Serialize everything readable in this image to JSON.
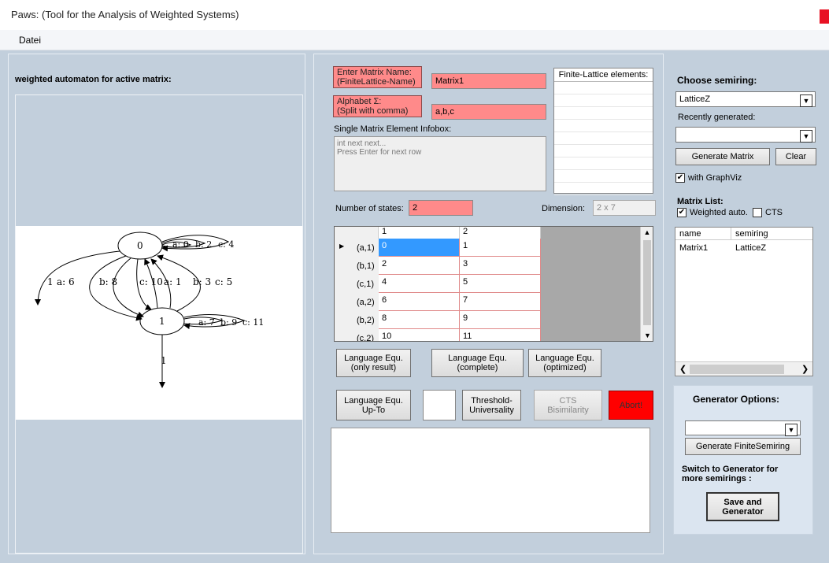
{
  "window": {
    "title": "Paws: (Tool for the Analysis of Weighted Systems)"
  },
  "menu": {
    "items": [
      "Datei"
    ]
  },
  "left_panel": {
    "heading": "weighted automaton for active matrix:",
    "graph": {
      "nodes": [
        "0",
        "1"
      ],
      "edge_labels": [
        "a: 0",
        "b: 2",
        "c: 4",
        "1",
        "a: 6",
        "b: 8",
        "c: 10",
        "a: 1",
        "b: 3",
        "c: 5",
        "a: 7",
        "b: 9",
        "c: 11",
        "1"
      ]
    }
  },
  "matrix_form": {
    "name_label": "Enter Matrix Name:\n(FiniteLattice-Name)",
    "name_value": "Matrix1",
    "alphabet_label": "Alphabet Σ:\n(Split with comma)",
    "alphabet_value": "a,b,c",
    "infobox_label": "Single Matrix Element Infobox:",
    "infobox_text": "int next next...\nPress Enter for next row",
    "states_label": "Number of states:",
    "states_value": "2",
    "dimension_label": "Dimension:",
    "dimension_value": "2 x 7",
    "lattice_header": "Finite-Lattice elements:"
  },
  "matrix_grid": {
    "columns": [
      "1",
      "2"
    ],
    "rows": [
      {
        "header": "(a,1)",
        "cells": [
          "0",
          "1"
        ],
        "current": true
      },
      {
        "header": "(b,1)",
        "cells": [
          "2",
          "3"
        ]
      },
      {
        "header": "(c,1)",
        "cells": [
          "4",
          "5"
        ]
      },
      {
        "header": "(a,2)",
        "cells": [
          "6",
          "7"
        ]
      },
      {
        "header": "(b,2)",
        "cells": [
          "8",
          "9"
        ]
      },
      {
        "header": "(c,2)",
        "cells": [
          "10",
          "11"
        ]
      }
    ]
  },
  "actions": {
    "lang_only_result": "Language Equ.\n(only result)",
    "lang_complete": "Language Equ.\n(complete)",
    "lang_optimized": "Language Equ.\n(optimized)",
    "lang_up_to": "Language Equ.\nUp-To",
    "threshold": "Threshold-\nUniversality",
    "cts_bisim": "CTS\nBisimilarity",
    "abort": "Abort!"
  },
  "semiring": {
    "heading": "Choose semiring:",
    "selected": "LatticeZ",
    "recent_label": "Recently  generated:",
    "recent_value": "",
    "generate_matrix": "Generate Matrix",
    "clear": "Clear",
    "with_graphviz": "with GraphViz",
    "with_graphviz_checked": true
  },
  "matrix_list": {
    "heading": "Matrix List:",
    "weighted_auto": "Weighted auto.",
    "weighted_checked": true,
    "cts": "CTS",
    "cts_checked": false,
    "columns": [
      "name",
      "semiring"
    ],
    "rows": [
      {
        "name": "Matrix1",
        "semiring": "LatticeZ"
      }
    ]
  },
  "generator": {
    "heading": "Generator Options:",
    "combo_value": "",
    "generate_finite": "Generate FiniteSemiring",
    "switch_text": "Switch to Generator for\nmore semirings :",
    "save_btn": "Save and\nGenerator"
  },
  "colors": {
    "accent_red": "#ff8a8a",
    "abort_red": "#ff0000",
    "selection_blue": "#3399ff",
    "panel_bg": "#c2cfdc"
  }
}
